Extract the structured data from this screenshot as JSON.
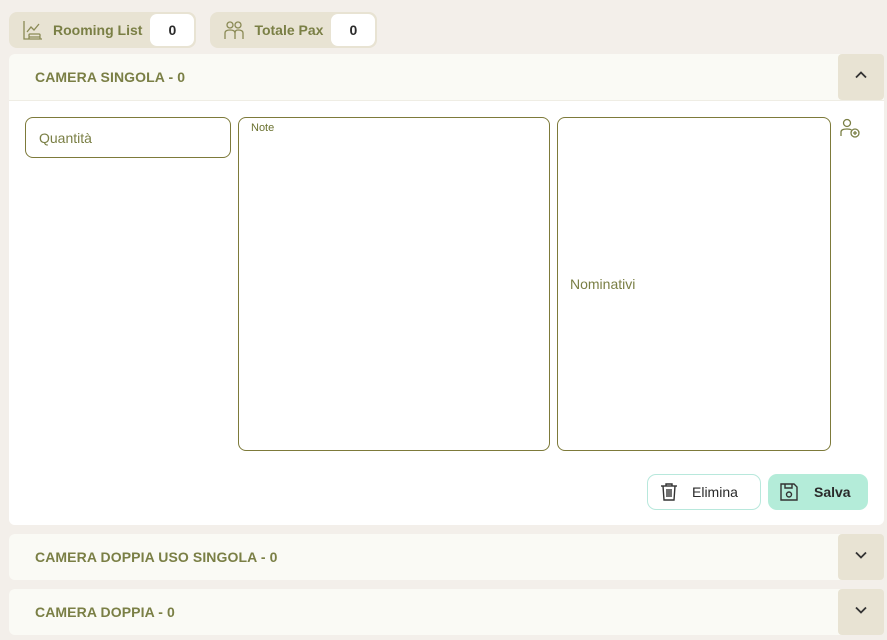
{
  "header": {
    "rooming_list": {
      "label": "Rooming List",
      "count": "0",
      "icon": "bed-chart-icon"
    },
    "totale_pax": {
      "label": "Totale Pax",
      "count": "0",
      "icon": "people-icon"
    }
  },
  "sections": [
    {
      "title": "CAMERA SINGOLA - 0",
      "expanded": true,
      "toggle_icon": "chevron-up-icon",
      "form": {
        "quantity_placeholder": "Quantità",
        "note_label": "Note",
        "names_placeholder": "Nominativi",
        "add_person_icon": "add-person-icon",
        "delete_label": "Elimina",
        "save_label": "Salva"
      }
    },
    {
      "title": "CAMERA DOPPIA USO SINGOLA - 0",
      "expanded": false,
      "toggle_icon": "chevron-down-icon"
    },
    {
      "title": "CAMERA DOPPIA - 0",
      "expanded": false,
      "toggle_icon": "chevron-down-icon"
    }
  ],
  "colors": {
    "accent_olive": "#7a7f45",
    "save_button": "#b4ecd9",
    "delete_border": "#b8e8dc",
    "background": "#f3efea",
    "chip_background": "#e8e3d3"
  }
}
